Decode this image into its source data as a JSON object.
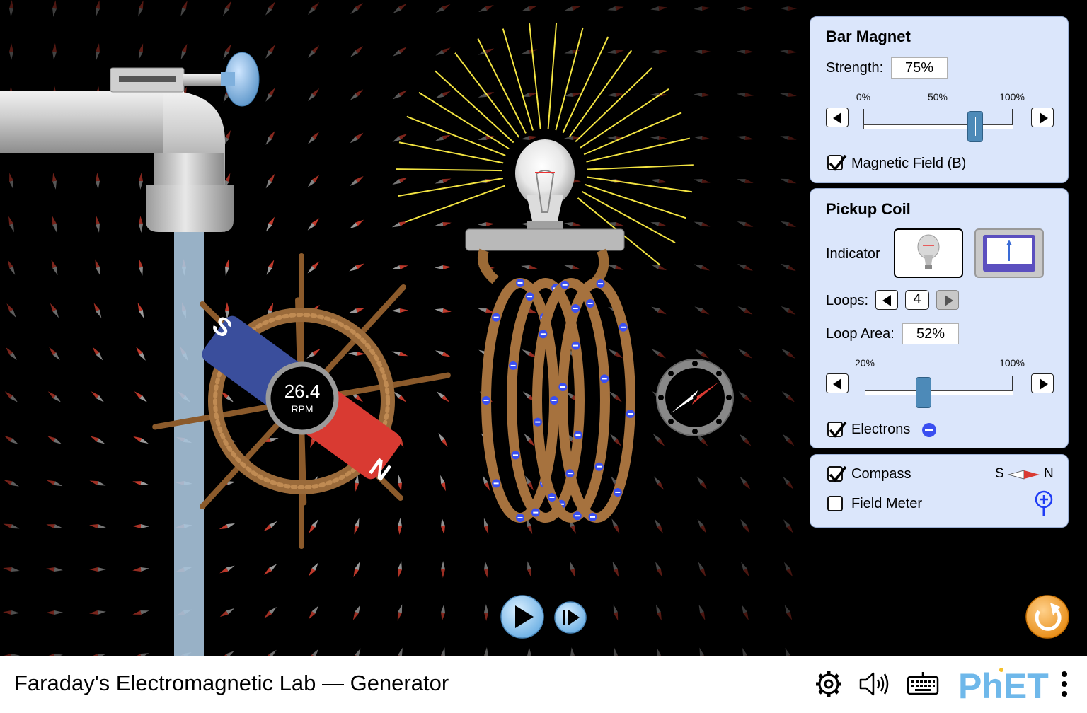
{
  "app": {
    "title": "Faraday's Electromagnetic Lab — Generator"
  },
  "magnet": {
    "south_label": "S",
    "north_label": "N"
  },
  "wheel": {
    "speed_value": "26.4",
    "speed_unit": "RPM"
  },
  "bar_magnet_panel": {
    "title": "Bar Magnet",
    "strength_label": "Strength:",
    "strength_value": "75%",
    "strength_fraction": 0.75,
    "ticks": [
      "0%",
      "50%",
      "100%"
    ],
    "magnetic_field_label": "Magnetic Field (B)",
    "magnetic_field_checked": true
  },
  "pickup_coil_panel": {
    "title": "Pickup Coil",
    "indicator_label": "Indicator",
    "indicator_selected": "lightbulb",
    "loops_label": "Loops:",
    "loops_value": "4",
    "loop_area_label": "Loop Area:",
    "loop_area_value": "52%",
    "loop_area_fraction": 0.4,
    "ticks": [
      "20%",
      "100%"
    ],
    "electrons_label": "Electrons",
    "electrons_checked": true
  },
  "tools_panel": {
    "compass_label": "Compass",
    "compass_checked": true,
    "compass_s": "S",
    "compass_n": "N",
    "field_meter_label": "Field Meter",
    "field_meter_checked": false
  },
  "colors": {
    "panel_bg": "#dbe6fb",
    "magnet_south": "#3a4e9c",
    "magnet_north": "#d93a32",
    "reset": "#f5a623",
    "play": "#8fc6f2"
  },
  "icons": [
    "settings-icon",
    "sound-icon",
    "keyboard-icon",
    "more-icon",
    "reset-icon",
    "play-icon",
    "step-icon"
  ],
  "brand": "PhET"
}
